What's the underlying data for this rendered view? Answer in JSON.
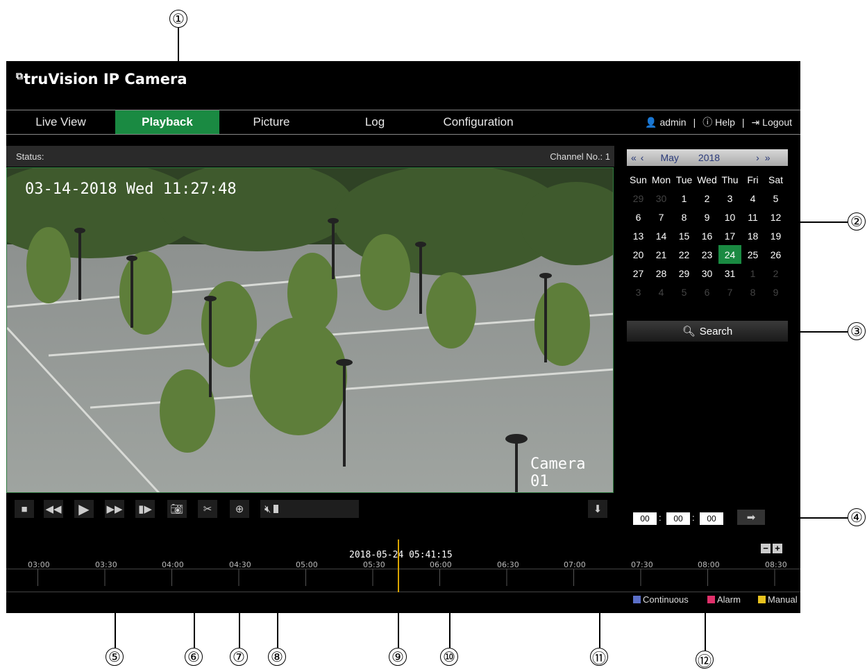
{
  "app": {
    "logo_text": "truVision IP Camera",
    "logo_icon": "camera-logo-icon"
  },
  "nav": {
    "tabs": [
      {
        "label": "Live View"
      },
      {
        "label": "Playback"
      },
      {
        "label": "Picture"
      },
      {
        "label": "Log"
      },
      {
        "label": "Configuration"
      }
    ],
    "active": "Playback",
    "user": "admin",
    "help": "Help",
    "logout": "Logout",
    "separator": "|"
  },
  "status": {
    "label": "Status:",
    "channel": "Channel No.: 1"
  },
  "video": {
    "timestamp": "03-14-2018 Wed 11:27:48",
    "camera_name": "Camera 01"
  },
  "calendar": {
    "month": "May",
    "year": "2018",
    "weekdays": [
      "Sun",
      "Mon",
      "Tue",
      "Wed",
      "Thu",
      "Fri",
      "Sat"
    ],
    "weeks": [
      [
        "29",
        "30",
        "1",
        "2",
        "3",
        "4",
        "5"
      ],
      [
        "6",
        "7",
        "8",
        "9",
        "10",
        "11",
        "12"
      ],
      [
        "13",
        "14",
        "15",
        "16",
        "17",
        "18",
        "19"
      ],
      [
        "20",
        "21",
        "22",
        "23",
        "24",
        "25",
        "26"
      ],
      [
        "27",
        "28",
        "29",
        "30",
        "31",
        "1",
        "2"
      ],
      [
        "3",
        "4",
        "5",
        "6",
        "7",
        "8",
        "9"
      ]
    ],
    "selected": "24"
  },
  "search": {
    "label": "Search"
  },
  "time_input": {
    "hh": "00",
    "mm": "00",
    "ss": "00",
    "sep": ":"
  },
  "timeline": {
    "current": "2018-05-24 05:41:15",
    "ticks": [
      "03:00",
      "03:30",
      "04:00",
      "04:30",
      "05:00",
      "05:30",
      "06:00",
      "06:30",
      "07:00",
      "07:30",
      "08:00",
      "08:30"
    ],
    "zoom_out": "−",
    "zoom_in": "+"
  },
  "legend": [
    {
      "label": "Continuous",
      "color": "#5b6fc8"
    },
    {
      "label": "Alarm",
      "color": "#e0306a"
    },
    {
      "label": "Manual",
      "color": "#e8c21e"
    }
  ],
  "colors": {
    "accent": "#1a8a42"
  },
  "callouts": [
    "①",
    "②",
    "③",
    "④",
    "⑤",
    "⑥",
    "⑦",
    "⑧",
    "⑨",
    "⑩",
    "⑪",
    "⑫"
  ]
}
